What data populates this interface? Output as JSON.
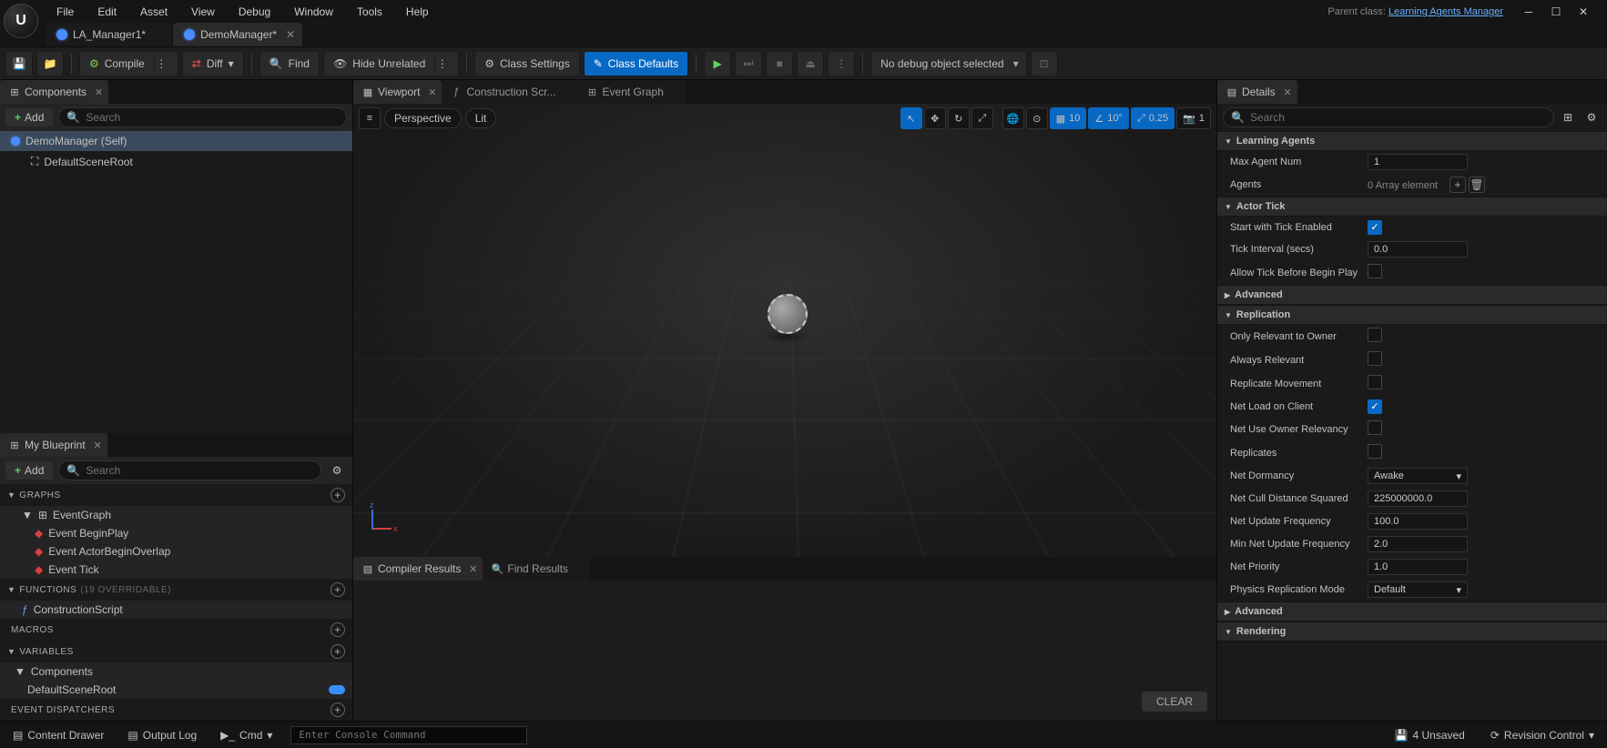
{
  "menu": [
    "File",
    "Edit",
    "Asset",
    "View",
    "Debug",
    "Window",
    "Tools",
    "Help"
  ],
  "parent_class_label": "Parent class:",
  "parent_class_link": "Learning Agents Manager",
  "fileTabs": [
    {
      "label": "LA_Manager1*",
      "active": false
    },
    {
      "label": "DemoManager*",
      "active": true
    }
  ],
  "toolbar": {
    "compile": "Compile",
    "diff": "Diff",
    "find": "Find",
    "hide_unrelated": "Hide Unrelated",
    "class_settings": "Class Settings",
    "class_defaults": "Class Defaults",
    "debug_select": "No debug object selected"
  },
  "components_panel": {
    "title": "Components",
    "add": "Add",
    "search_placeholder": "Search",
    "tree": [
      {
        "label": "DemoManager (Self)",
        "selected": true,
        "indent": 0
      },
      {
        "label": "DefaultSceneRoot",
        "selected": false,
        "indent": 1
      }
    ]
  },
  "myblueprint": {
    "title": "My Blueprint",
    "add": "Add",
    "search_placeholder": "Search",
    "sections": {
      "graphs": "Graphs",
      "functions": "Functions",
      "functions_sub": "(19 OVERRIDABLE)",
      "macros": "Macros",
      "variables": "Variables",
      "components_var": "Components",
      "event_dispatchers": "Event Dispatchers"
    },
    "graph_root": "EventGraph",
    "events": [
      "Event BeginPlay",
      "Event ActorBeginOverlap",
      "Event Tick"
    ],
    "functions": [
      "ConstructionScript"
    ],
    "var_items": [
      "DefaultSceneRoot"
    ]
  },
  "center_tabs": {
    "viewport": "Viewport",
    "construction": "Construction Scr...",
    "event_graph": "Event Graph"
  },
  "viewport": {
    "perspective": "Perspective",
    "lit": "Lit",
    "grid": "10",
    "angle": "10°",
    "scale": "0.25",
    "cam": "1"
  },
  "results_tabs": {
    "compiler": "Compiler Results",
    "find": "Find Results"
  },
  "clear_btn": "CLEAR",
  "details": {
    "title": "Details",
    "search_placeholder": "Search",
    "categories": {
      "learning_agents": "Learning Agents",
      "actor_tick": "Actor Tick",
      "replication": "Replication",
      "rendering": "Rendering",
      "advanced": "Advanced"
    },
    "props": {
      "max_agent_num": {
        "label": "Max Agent Num",
        "value": "1"
      },
      "agents": {
        "label": "Agents",
        "value": "0 Array element"
      },
      "start_with_tick": {
        "label": "Start with Tick Enabled",
        "checked": true
      },
      "tick_interval": {
        "label": "Tick Interval (secs)",
        "value": "0.0"
      },
      "allow_tick_before": {
        "label": "Allow Tick Before Begin Play",
        "checked": false
      },
      "only_relevant_owner": {
        "label": "Only Relevant to Owner",
        "checked": false
      },
      "always_relevant": {
        "label": "Always Relevant",
        "checked": false
      },
      "replicate_movement": {
        "label": "Replicate Movement",
        "checked": false
      },
      "net_load_client": {
        "label": "Net Load on Client",
        "checked": true
      },
      "net_use_owner_relevancy": {
        "label": "Net Use Owner Relevancy",
        "checked": false
      },
      "replicates": {
        "label": "Replicates",
        "checked": false
      },
      "net_dormancy": {
        "label": "Net Dormancy",
        "value": "Awake"
      },
      "net_cull_distance": {
        "label": "Net Cull Distance Squared",
        "value": "225000000.0"
      },
      "net_update_freq": {
        "label": "Net Update Frequency",
        "value": "100.0"
      },
      "min_net_update_freq": {
        "label": "Min Net Update Frequency",
        "value": "2.0"
      },
      "net_priority": {
        "label": "Net Priority",
        "value": "1.0"
      },
      "physics_replication": {
        "label": "Physics Replication Mode",
        "value": "Default"
      }
    }
  },
  "statusbar": {
    "content_drawer": "Content Drawer",
    "output_log": "Output Log",
    "cmd": "Cmd",
    "console_placeholder": "Enter Console Command",
    "unsaved": "4 Unsaved",
    "revision": "Revision Control"
  }
}
